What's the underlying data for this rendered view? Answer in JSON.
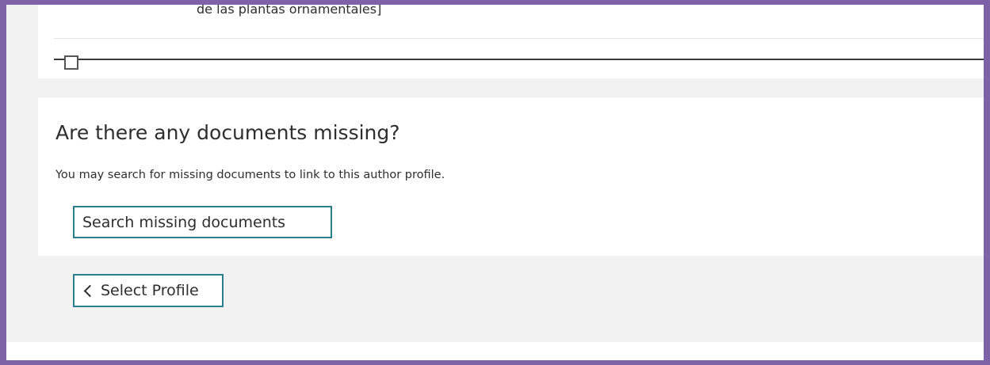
{
  "results_list": {
    "visible_item_title_fragment": "de las plantas ornamentales]"
  },
  "missing_documents": {
    "heading": "Are there any documents missing?",
    "description": "You may search for missing documents to link to this author profile.",
    "search_button_label": "Search missing documents"
  },
  "navigation": {
    "select_profile_label": "Select Profile",
    "back_icon": "chevron-left-icon"
  },
  "colors": {
    "frame_border": "#7e62a8",
    "button_border": "#2a7f8f",
    "page_background": "#f2f2f2",
    "card_background": "#ffffff"
  }
}
